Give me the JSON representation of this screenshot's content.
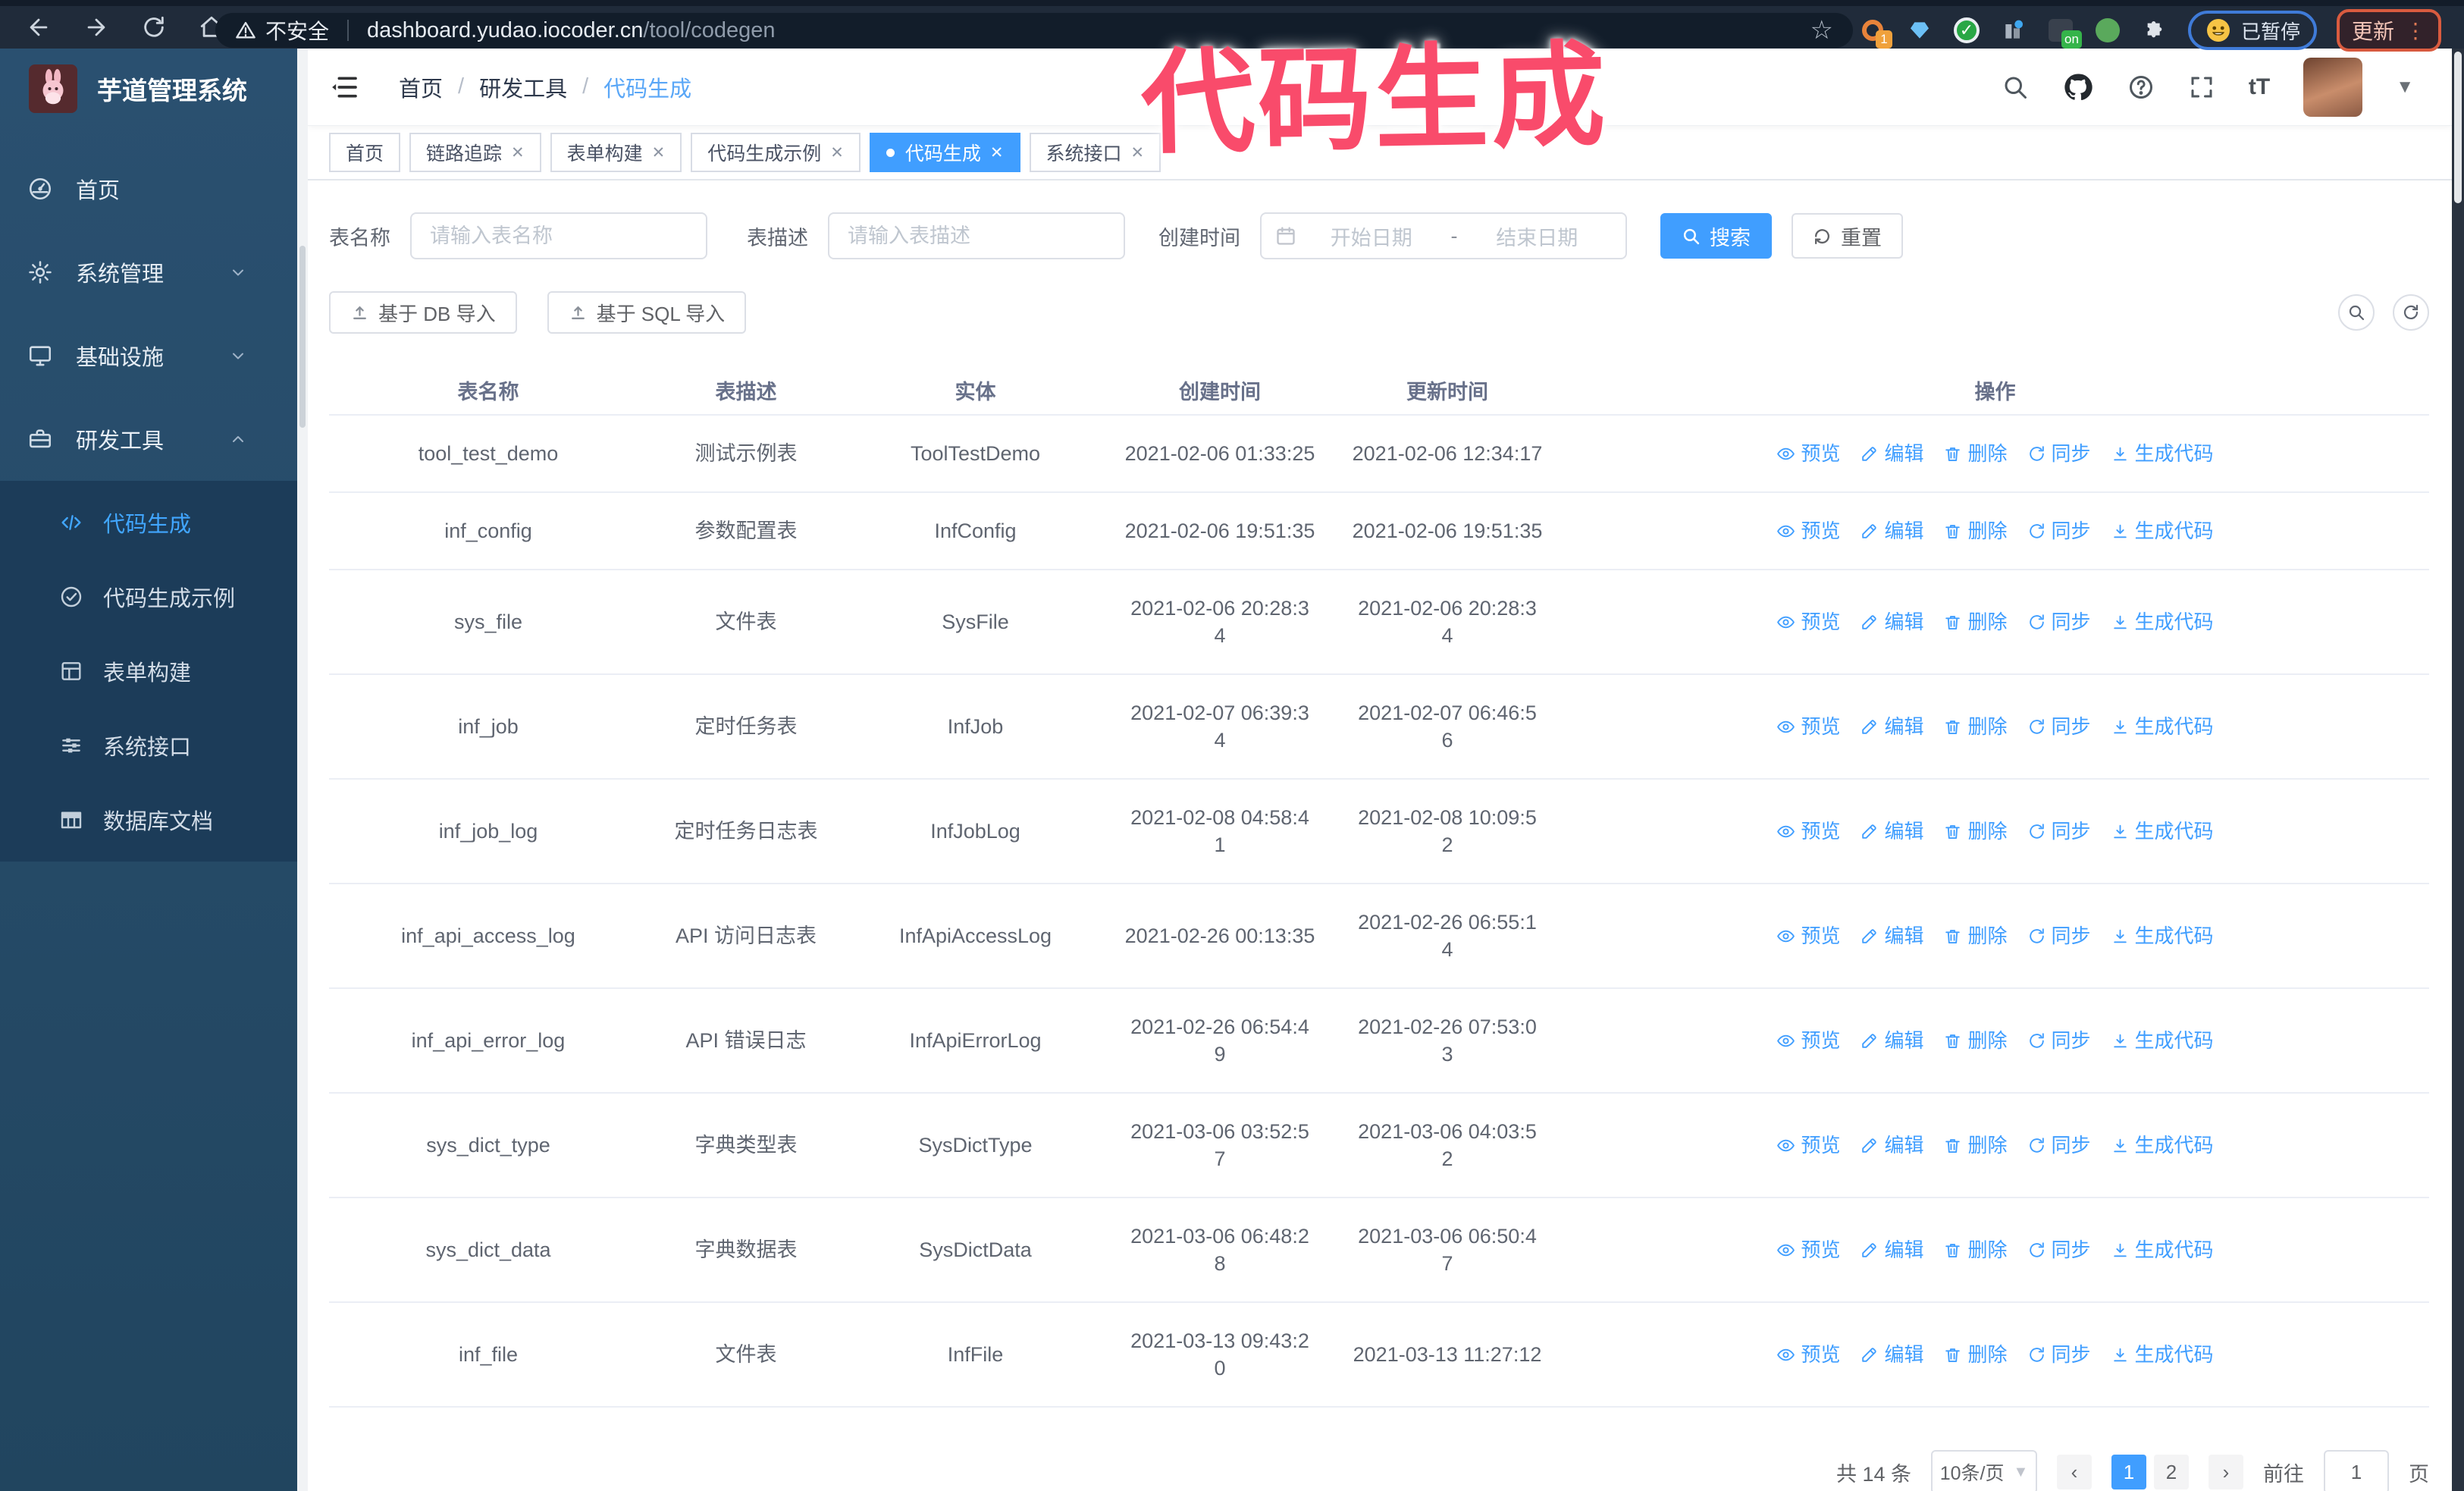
{
  "browser": {
    "security_label": "不安全",
    "url_host": "dashboard.yudao.iocoder.cn",
    "url_path": "/tool/codegen",
    "extension_badge_1": "1",
    "extension_badge_on": "on",
    "paused_badge": "已暂停",
    "update_button": "更新"
  },
  "annotation": {
    "text": "代码生成"
  },
  "sidebar": {
    "title": "芋道管理系统",
    "menu": [
      {
        "label": "首页",
        "icon": "dashboard",
        "chevron": null,
        "active": false
      },
      {
        "label": "系统管理",
        "icon": "gear",
        "chevron": "down",
        "active": false
      },
      {
        "label": "基础设施",
        "icon": "monitor",
        "chevron": "down",
        "active": false
      },
      {
        "label": "研发工具",
        "icon": "toolbox",
        "chevron": "up",
        "active": false
      }
    ],
    "submenu": [
      {
        "label": "代码生成",
        "icon": "code",
        "active": true
      },
      {
        "label": "代码生成示例",
        "icon": "example",
        "active": false
      },
      {
        "label": "表单构建",
        "icon": "form",
        "active": false
      },
      {
        "label": "系统接口",
        "icon": "api",
        "active": false
      },
      {
        "label": "数据库文档",
        "icon": "database",
        "active": false
      }
    ]
  },
  "navbar": {
    "breadcrumb": [
      "首页",
      "研发工具",
      "代码生成"
    ]
  },
  "tabs": [
    {
      "label": "首页",
      "closable": false,
      "active": false
    },
    {
      "label": "链路追踪",
      "closable": true,
      "active": false
    },
    {
      "label": "表单构建",
      "closable": true,
      "active": false
    },
    {
      "label": "代码生成示例",
      "closable": true,
      "active": false
    },
    {
      "label": "代码生成",
      "closable": true,
      "active": true
    },
    {
      "label": "系统接口",
      "closable": true,
      "active": false
    }
  ],
  "filter": {
    "name_label": "表名称",
    "name_placeholder": "请输入表名称",
    "desc_label": "表描述",
    "desc_placeholder": "请输入表描述",
    "time_label": "创建时间",
    "start_placeholder": "开始日期",
    "range_separator": "-",
    "end_placeholder": "结束日期",
    "search_label": "搜索",
    "reset_label": "重置"
  },
  "toolbar": {
    "import_db": "基于 DB 导入",
    "import_sql": "基于 SQL 导入"
  },
  "table": {
    "columns": [
      "表名称",
      "表描述",
      "实体",
      "创建时间",
      "更新时间",
      "操作"
    ],
    "action_labels": [
      "预览",
      "编辑",
      "删除",
      "同步",
      "生成代码"
    ],
    "rows": [
      {
        "name": "tool_test_demo",
        "desc": "测试示例表",
        "entity": "ToolTestDemo",
        "created": "2021-02-06 01:33:25",
        "created_wrap": false,
        "updated": "2021-02-06 12:34:17",
        "updated_wrap": false
      },
      {
        "name": "inf_config",
        "desc": "参数配置表",
        "entity": "InfConfig",
        "created": "2021-02-06 19:51:35",
        "created_wrap": false,
        "updated": "2021-02-06 19:51:35",
        "updated_wrap": false
      },
      {
        "name": "sys_file",
        "desc": "文件表",
        "entity": "SysFile",
        "created": "2021-02-06 20:28:34",
        "created_wrap": true,
        "updated": "2021-02-06 20:28:34",
        "updated_wrap": true
      },
      {
        "name": "inf_job",
        "desc": "定时任务表",
        "entity": "InfJob",
        "created": "2021-02-07 06:39:34",
        "created_wrap": true,
        "updated": "2021-02-07 06:46:56",
        "updated_wrap": true
      },
      {
        "name": "inf_job_log",
        "desc": "定时任务日志表",
        "entity": "InfJobLog",
        "created": "2021-02-08 04:58:41",
        "created_wrap": true,
        "updated": "2021-02-08 10:09:52",
        "updated_wrap": true
      },
      {
        "name": "inf_api_access_log",
        "desc": "API 访问日志表",
        "entity": "InfApiAccessLog",
        "created": "2021-02-26 00:13:35",
        "created_wrap": false,
        "updated": "2021-02-26 06:55:14",
        "updated_wrap": true
      },
      {
        "name": "inf_api_error_log",
        "desc": "API 错误日志",
        "entity": "InfApiErrorLog",
        "created": "2021-02-26 06:54:49",
        "created_wrap": true,
        "updated": "2021-02-26 07:53:03",
        "updated_wrap": true
      },
      {
        "name": "sys_dict_type",
        "desc": "字典类型表",
        "entity": "SysDictType",
        "created": "2021-03-06 03:52:57",
        "created_wrap": true,
        "updated": "2021-03-06 04:03:52",
        "updated_wrap": true
      },
      {
        "name": "sys_dict_data",
        "desc": "字典数据表",
        "entity": "SysDictData",
        "created": "2021-03-06 06:48:28",
        "created_wrap": true,
        "updated": "2021-03-06 06:50:47",
        "updated_wrap": true
      },
      {
        "name": "inf_file",
        "desc": "文件表",
        "entity": "InfFile",
        "created": "2021-03-13 09:43:20",
        "created_wrap": true,
        "updated": "2021-03-13 11:27:12",
        "updated_wrap": false
      }
    ]
  },
  "pagination": {
    "total": "共 14 条",
    "page_size": "10条/页",
    "pages": [
      "1",
      "2"
    ],
    "active_page": "1",
    "goto_label": "前往",
    "goto_value": "1",
    "unit_label": "页"
  }
}
